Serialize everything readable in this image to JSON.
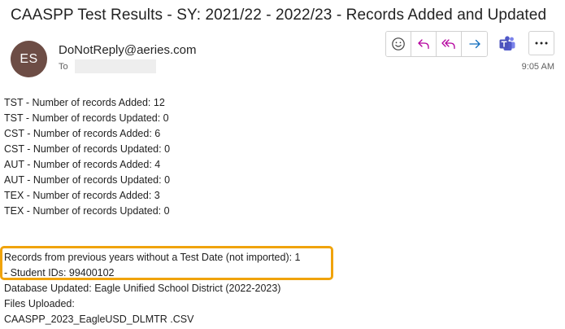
{
  "email": {
    "subject": "CAASPP Test Results - SY: 2021/22 - 2022/23 - Records Added and Updated",
    "sender_initials": "ES",
    "sender": "DoNotReply@aeries.com",
    "to_label": "To",
    "time": "9:05 AM"
  },
  "actions": {
    "emoji_icon": "smile-icon",
    "reply_icon": "reply-icon",
    "reply_all_icon": "reply-all-icon",
    "forward_icon": "forward-icon",
    "teams_icon": "teams-icon",
    "more_icon": "more-icon"
  },
  "colors": {
    "avatar": "#6d4d45",
    "reply": "#b4009e",
    "forward": "#0f6cbd",
    "teams": "#5059c9",
    "highlight": "#f0a30a"
  },
  "body": {
    "stats": [
      "TST - Number of records Added: 12",
      "TST - Number of records Updated: 0",
      "CST - Number of records Added: 6",
      "CST - Number of records Updated: 0",
      "AUT - Number of records Added: 4",
      "AUT - Number of records Updated: 0",
      "TEX - Number of records Added: 3",
      "TEX - Number of records Updated: 0"
    ],
    "previous_years_line1": "Records from previous years without a Test Date (not imported): 1",
    "previous_years_line2": "- Student IDs: 99400102",
    "database_updated": "Database Updated: Eagle Unified School District  (2022-2023)",
    "files_uploaded_label": "Files Uploaded:",
    "file_name": "CAASPP_2023_EagleUSD_DLMTR .CSV"
  }
}
